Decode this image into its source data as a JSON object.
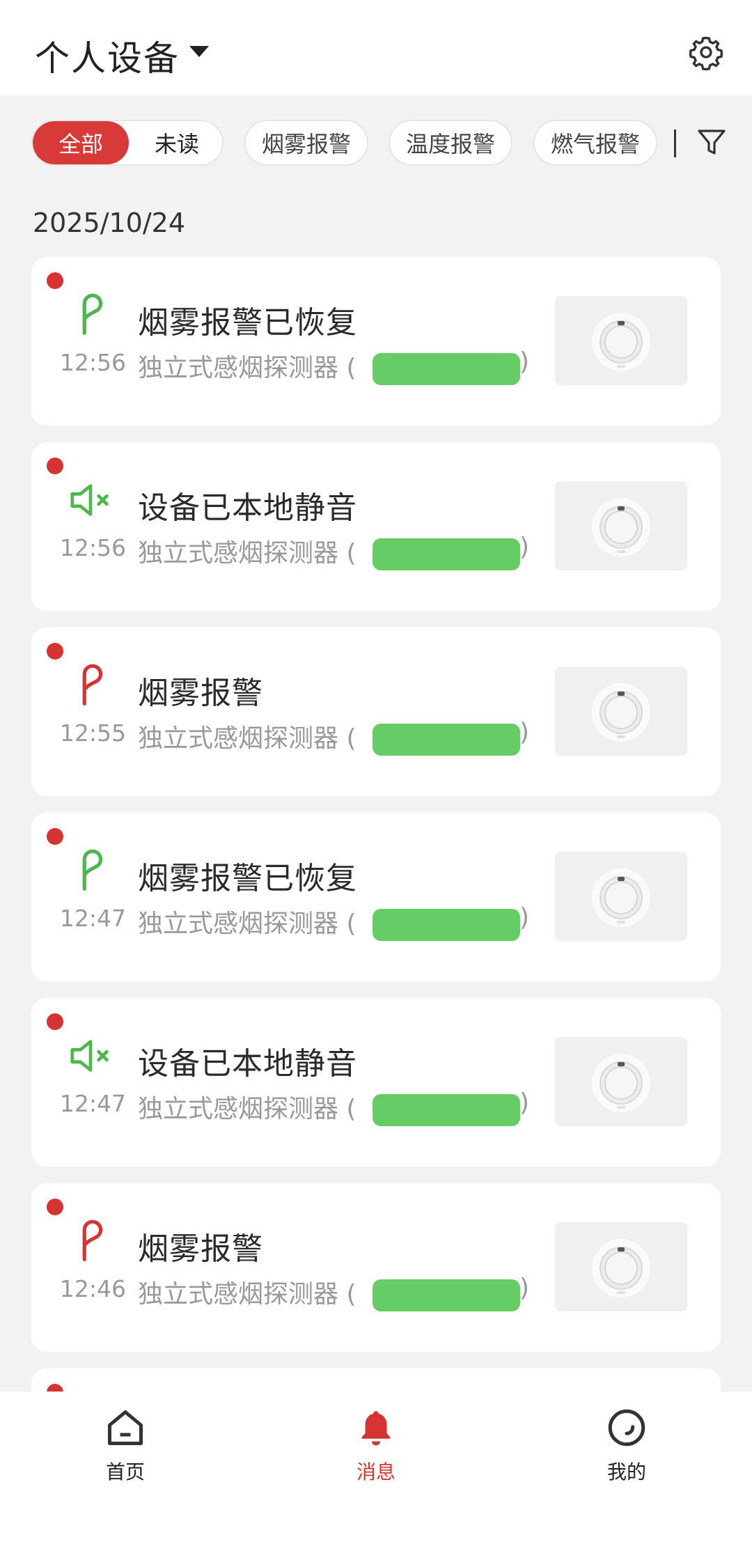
{
  "header": {
    "title": "个人设备"
  },
  "filters": {
    "segment": [
      "全部",
      "未读"
    ],
    "chips": [
      "烟雾报警",
      "温度报警",
      "燃气报警"
    ]
  },
  "date": "2025/10/24",
  "messages": [
    {
      "title": "烟雾报警已恢复",
      "time": "12:56",
      "device": "独立式感烟探测器 (",
      "device_close": ")",
      "kind": "smoke-restored",
      "unread": true
    },
    {
      "title": "设备已本地静音",
      "time": "12:56",
      "device": "独立式感烟探测器 (",
      "device_close": ")",
      "kind": "muted",
      "unread": true
    },
    {
      "title": "烟雾报警",
      "time": "12:55",
      "device": "独立式感烟探测器 (",
      "device_close": ")",
      "kind": "smoke-alarm",
      "unread": true
    },
    {
      "title": "烟雾报警已恢复",
      "time": "12:47",
      "device": "独立式感烟探测器 (",
      "device_close": ")",
      "kind": "smoke-restored",
      "unread": true
    },
    {
      "title": "设备已本地静音",
      "time": "12:47",
      "device": "独立式感烟探测器 (",
      "device_close": ")",
      "kind": "muted",
      "unread": true
    },
    {
      "title": "烟雾报警",
      "time": "12:46",
      "device": "独立式感烟探测器 (",
      "device_close": ")",
      "kind": "smoke-alarm",
      "unread": true
    }
  ],
  "tabs": [
    {
      "label": "首页",
      "icon": "home-icon"
    },
    {
      "label": "消息",
      "icon": "bell-icon"
    },
    {
      "label": "我的",
      "icon": "smile-icon"
    }
  ],
  "colors": {
    "accent": "#d83a3a",
    "success": "#4cb84c",
    "alert": "#d63333"
  }
}
